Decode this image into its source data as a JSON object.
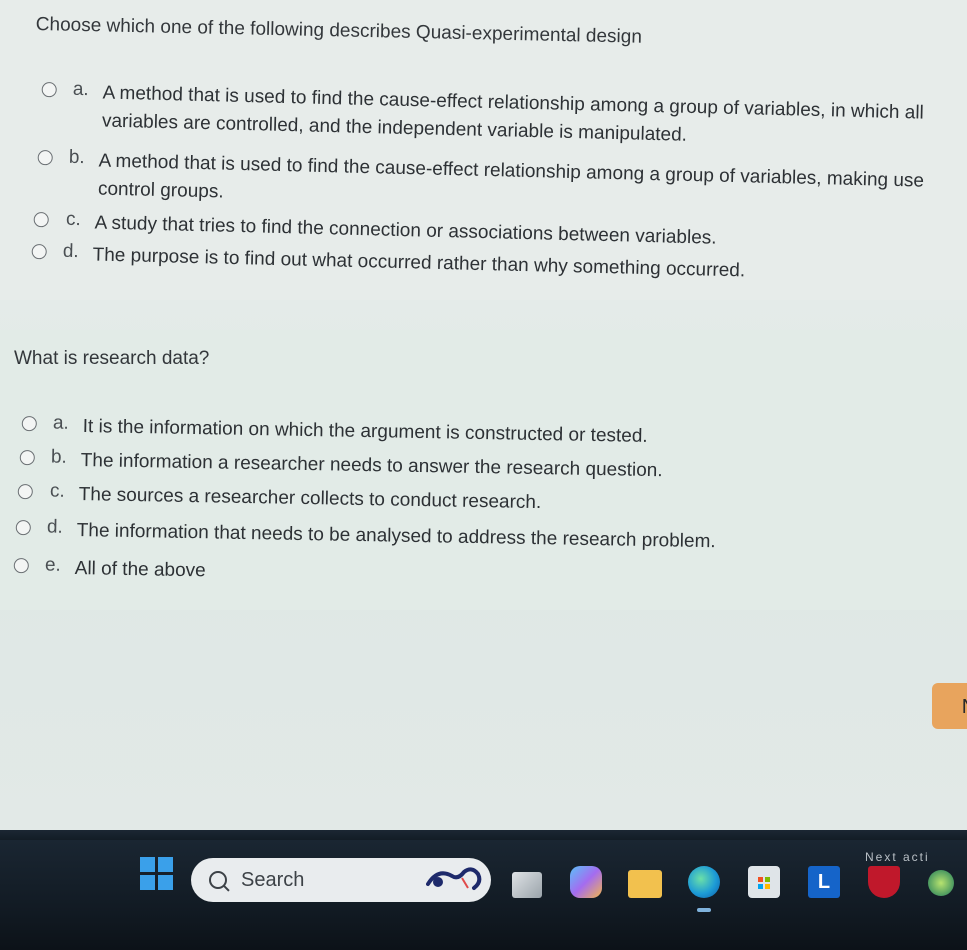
{
  "question1": {
    "prompt": "Choose which one of the following describes Quasi-experimental design",
    "options": [
      {
        "letter": "a.",
        "line1": "A method that is used to find the cause-effect relationship among a group of variables, in which all",
        "line2": "variables are controlled, and the independent variable is manipulated."
      },
      {
        "letter": "b.",
        "line1": "A method that is used to find the cause-effect relationship among a group of variables, making use",
        "line2": "control groups."
      },
      {
        "letter": "c.",
        "line1": "A study that tries to find the connection or associations between variables."
      },
      {
        "letter": "d.",
        "line1": "The purpose is to find out what occurred rather than why something occurred."
      }
    ]
  },
  "question2": {
    "prompt": "What is research data?",
    "options": [
      {
        "letter": "a.",
        "text": "It is the information on which the argument is constructed or tested."
      },
      {
        "letter": "b.",
        "text": "The information a researcher needs to answer the research question."
      },
      {
        "letter": "c.",
        "text": "The sources a researcher collects to conduct research."
      },
      {
        "letter": "d.",
        "text": "The information that needs to be analysed to address the research problem."
      },
      {
        "letter": "e.",
        "text": "All of the above"
      }
    ]
  },
  "next_button": {
    "label": "N"
  },
  "taskbar": {
    "search_label": "Search",
    "notice_label": "Next acti",
    "l_app_label": "L",
    "icons": [
      "windows-start-icon",
      "search-icon",
      "task-view-icon",
      "copilot-icon",
      "file-explorer-icon",
      "edge-icon",
      "microsoft-store-icon",
      "l-app-icon",
      "mcafee-icon",
      "app-icon"
    ]
  },
  "colors": {
    "next_button": "#e8a45d",
    "taskbar": "#121b24",
    "page_bg": "#e6ecea"
  }
}
